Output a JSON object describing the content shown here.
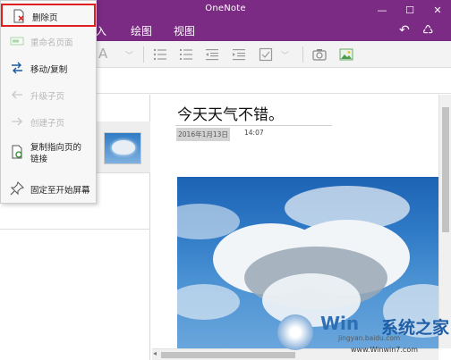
{
  "window": {
    "title": "OneNote"
  },
  "ribbon": {
    "tabs": [
      "入",
      "绘图",
      "视图"
    ]
  },
  "context_menu": {
    "items": [
      {
        "label": "删除页",
        "icon": "delete-page-icon",
        "enabled": true,
        "highlighted": true
      },
      {
        "label": "重命名页面",
        "icon": "rename-icon",
        "enabled": false
      },
      {
        "label": "移动/复制",
        "icon": "move-copy-icon",
        "enabled": true
      },
      {
        "label": "升级子页",
        "icon": "arrow-left-icon",
        "enabled": false
      },
      {
        "label": "创建子页",
        "icon": "arrow-right-icon",
        "enabled": false
      },
      {
        "label": "复制指向页的链接",
        "icon": "copy-link-icon",
        "enabled": true
      },
      {
        "label": "固定至开始屏幕",
        "icon": "pin-icon",
        "enabled": true
      }
    ],
    "link_line1": "复制指向页的",
    "link_line2": "链接"
  },
  "page": {
    "title": "今天天气不错。",
    "date": "2016年1月13日",
    "time": "14:07"
  },
  "watermark": {
    "brand_w": "Win",
    "brand_rest": "系统之家",
    "url_top": "jingyan.baidu.com",
    "url_bottom": "www.Winwin7.com"
  },
  "colors": {
    "titlebar": "#7b2b83",
    "highlight_border": "#e02020"
  }
}
